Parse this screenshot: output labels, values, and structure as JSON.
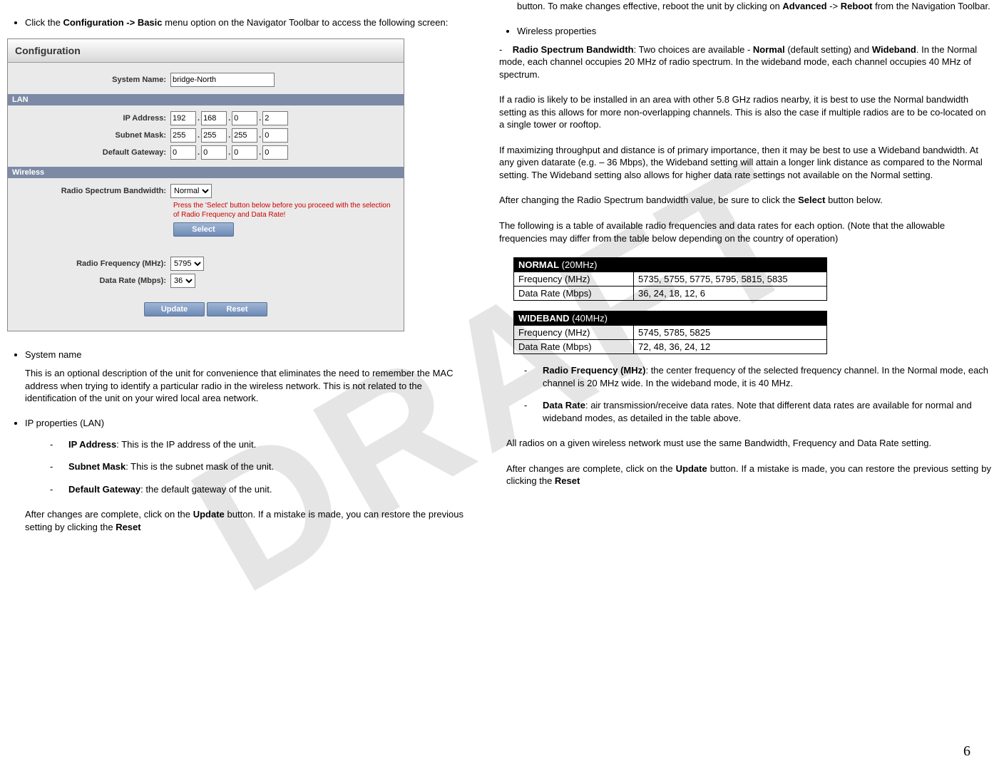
{
  "watermark": "DRAFT",
  "page_number": "6",
  "left": {
    "intro_pre": "Click the ",
    "intro_bold": "Configuration -> Basic",
    "intro_post": " menu option on the Navigator Toolbar to access the following screen:",
    "config": {
      "title": "Configuration",
      "system_name_label": "System Name:",
      "system_name_value": "bridge-North",
      "lan_header": "LAN",
      "ip_label": "IP Address:",
      "ip": [
        "192",
        "168",
        "0",
        "2"
      ],
      "subnet_label": "Subnet Mask:",
      "subnet": [
        "255",
        "255",
        "255",
        "0"
      ],
      "gw_label": "Default Gateway:",
      "gw": [
        "0",
        "0",
        "0",
        "0"
      ],
      "wireless_header": "Wireless",
      "bw_label": "Radio Spectrum Bandwidth:",
      "bw_value": "Normal",
      "warn": "Press the 'Select' button below before you proceed with the selection of Radio Frequency and Data Rate!",
      "select_btn": "Select",
      "rf_label": "Radio Frequency (MHz):",
      "rf_value": "5795",
      "dr_label": "Data Rate (Mbps):",
      "dr_value": "36",
      "update_btn": "Update",
      "reset_btn": "Reset"
    },
    "sysname_h": "System name",
    "sysname_p": "This is an optional description of the unit for convenience that eliminates the need to remember the MAC address when trying to identify a particular radio in the wireless network.  This is not related to the identification of the unit on your wired local area network.",
    "ipprop_h": "IP properties (LAN)",
    "ip_items": [
      {
        "b": "IP Address",
        "t": ": This is the IP address of the unit."
      },
      {
        "b": "Subnet Mask",
        "t": ": This is the subnet mask of the unit."
      },
      {
        "b": "Default Gateway",
        "t": ": the default gateway of the unit."
      }
    ],
    "after1_a": "After changes are complete, click on the ",
    "after1_b": "Update",
    "after1_c": " button.  If a mistake is made, you can restore the previous setting by clicking the ",
    "after1_d": "Reset"
  },
  "right": {
    "cont_a": "button.  To make changes effective, reboot the unit by clicking on ",
    "cont_b": "Advanced",
    "cont_c": " -> ",
    "cont_d": "Reboot",
    "cont_e": " from the Navigation Toolbar.",
    "wprops": "Wireless properties",
    "rsb_label": "Radio Spectrum Bandwidth",
    "rsb_t1": ":  Two choices are available - ",
    "rsb_normal": "Normal",
    "rsb_t2": " (default setting) and ",
    "rsb_wide": "Wideband",
    "rsb_t3": ".   In the Normal mode, each channel occupies 20 MHz of radio spectrum.  In the wideband mode, each channel occupies 40 MHz of spectrum.",
    "p2": "If a radio is likely to be installed in an area with other 5.8 GHz radios nearby, it is best to use the Normal bandwidth setting as this allows for more non-overlapping channels.  This is also the case if multiple radios are to be co-located on a single tower or rooftop.",
    "p3": "If maximizing throughput and distance is of primary importance, then it may be best to use a Wideband bandwidth.  At any given datarate (e.g. – 36 Mbps), the Wideband setting will attain a longer link distance as compared to the Normal setting.  The Wideband setting also allows for higher data rate settings not available on the Normal setting.",
    "p4_a": "After changing the Radio Spectrum bandwidth value, be sure to click the ",
    "p4_b": "Select",
    "p4_c": " button below.",
    "p5": "The following is a table of available radio frequencies and data rates for each option.  (Note that the allowable frequencies may differ from the table below depending on the country of operation)",
    "tbl_normal": {
      "hdr_b": "NORMAL",
      "hdr_s": " (20MHz)",
      "r1a": "Frequency (MHz)",
      "r1b": "5735, 5755, 5775, 5795, 5815, 5835",
      "r2a": "Data Rate (Mbps)",
      "r2b": "36, 24, 18, 12, 6"
    },
    "tbl_wide": {
      "hdr_b": "WIDEBAND",
      "hdr_s": " (40MHz)",
      "r1a": "Frequency (MHz)",
      "r1b": "5745, 5785, 5825",
      "r2a": "Data Rate (Mbps)",
      "r2b": "72, 48, 36, 24, 12"
    },
    "rf_b": "Radio Frequency (MHz)",
    "rf_t": ": the center frequency of the selected frequency channel. In the Normal mode, each channel is 20 MHz wide. In the wideband mode, it is 40 MHz.",
    "dr_b": "Data Rate",
    "dr_t": ": air transmission/receive data rates. Note that different data rates are available for normal and wideband modes, as detailed in the table above.",
    "p6": "All radios on a given wireless network must use the same Bandwidth, Frequency and Data Rate setting.",
    "p7_a": "After changes are complete, click on the ",
    "p7_b": "Update",
    "p7_c": " button.  If a mistake is made, you can restore the previous setting by clicking the ",
    "p7_d": "Reset"
  }
}
